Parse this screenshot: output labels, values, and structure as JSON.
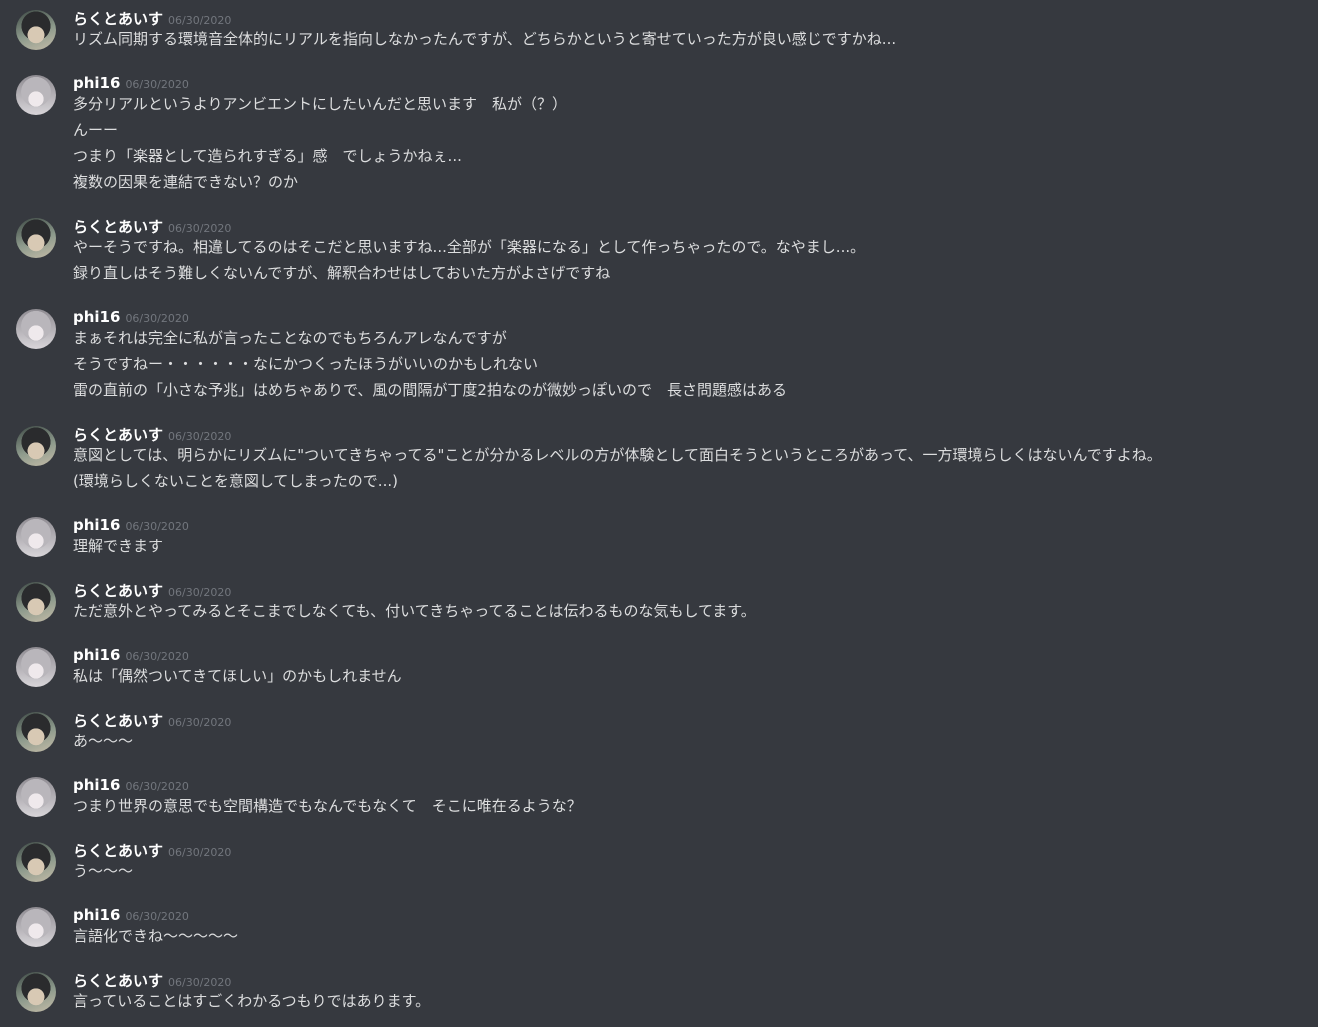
{
  "messages": [
    {
      "author": "らくとあいす",
      "avatar": "raku-avatar",
      "timestamp": "06/30/2020",
      "lines": [
        "リズム同期する環境音全体的にリアルを指向しなかったんですが、どちらかというと寄せていった方が良い感じですかね..."
      ]
    },
    {
      "author": "phi16",
      "avatar": "phi-avatar",
      "timestamp": "06/30/2020",
      "lines": [
        "多分リアルというよりアンビエントにしたいんだと思います　私が（？）",
        "んーー",
        "つまり「楽器として造られすぎる」感　でしょうかねぇ...",
        "複数の因果を連結できない？のか"
      ]
    },
    {
      "author": "らくとあいす",
      "avatar": "raku-avatar",
      "timestamp": "06/30/2020",
      "lines": [
        "やーそうですね。相違してるのはそこだと思いますね...全部が「楽器になる」として作っちゃったので。なやまし...。",
        "録り直しはそう難しくないんですが、解釈合わせはしておいた方がよさげですね"
      ]
    },
    {
      "author": "phi16",
      "avatar": "phi-avatar",
      "timestamp": "06/30/2020",
      "lines": [
        "まぁそれは完全に私が言ったことなのでもちろんアレなんですが",
        "そうですねー・・・・・・なにかつくったほうがいいのかもしれない",
        "雷の直前の「小さな予兆」はめちゃありで、風の間隔が丁度2拍なのが微妙っぽいので　長さ問題感はある"
      ]
    },
    {
      "author": "らくとあいす",
      "avatar": "raku-avatar",
      "timestamp": "06/30/2020",
      "lines": [
        "意図としては、明らかにリズムに\"ついてきちゃってる\"ことが分かるレベルの方が体験として面白そうというところがあって、一方環境らしくはないんですよね。",
        "(環境らしくないことを意図してしまったので...)"
      ]
    },
    {
      "author": "phi16",
      "avatar": "phi-avatar",
      "timestamp": "06/30/2020",
      "lines": [
        "理解できます"
      ]
    },
    {
      "author": "らくとあいす",
      "avatar": "raku-avatar",
      "timestamp": "06/30/2020",
      "lines": [
        "ただ意外とやってみるとそこまでしなくても、付いてきちゃってることは伝わるものな気もしてます。"
      ]
    },
    {
      "author": "phi16",
      "avatar": "phi-avatar",
      "timestamp": "06/30/2020",
      "lines": [
        "私は「偶然ついてきてほしい」のかもしれません"
      ]
    },
    {
      "author": "らくとあいす",
      "avatar": "raku-avatar",
      "timestamp": "06/30/2020",
      "lines": [
        "あ〜〜〜"
      ]
    },
    {
      "author": "phi16",
      "avatar": "phi-avatar",
      "timestamp": "06/30/2020",
      "lines": [
        "つまり世界の意思でも空間構造でもなんでもなくて　そこに唯在るような？"
      ]
    },
    {
      "author": "らくとあいす",
      "avatar": "raku-avatar",
      "timestamp": "06/30/2020",
      "lines": [
        "う〜〜〜"
      ]
    },
    {
      "author": "phi16",
      "avatar": "phi-avatar",
      "timestamp": "06/30/2020",
      "lines": [
        "言語化できね〜〜〜〜〜"
      ]
    },
    {
      "author": "らくとあいす",
      "avatar": "raku-avatar",
      "timestamp": "06/30/2020",
      "lines": [
        "言っていることはすごくわかるつもりではあります。"
      ]
    }
  ]
}
